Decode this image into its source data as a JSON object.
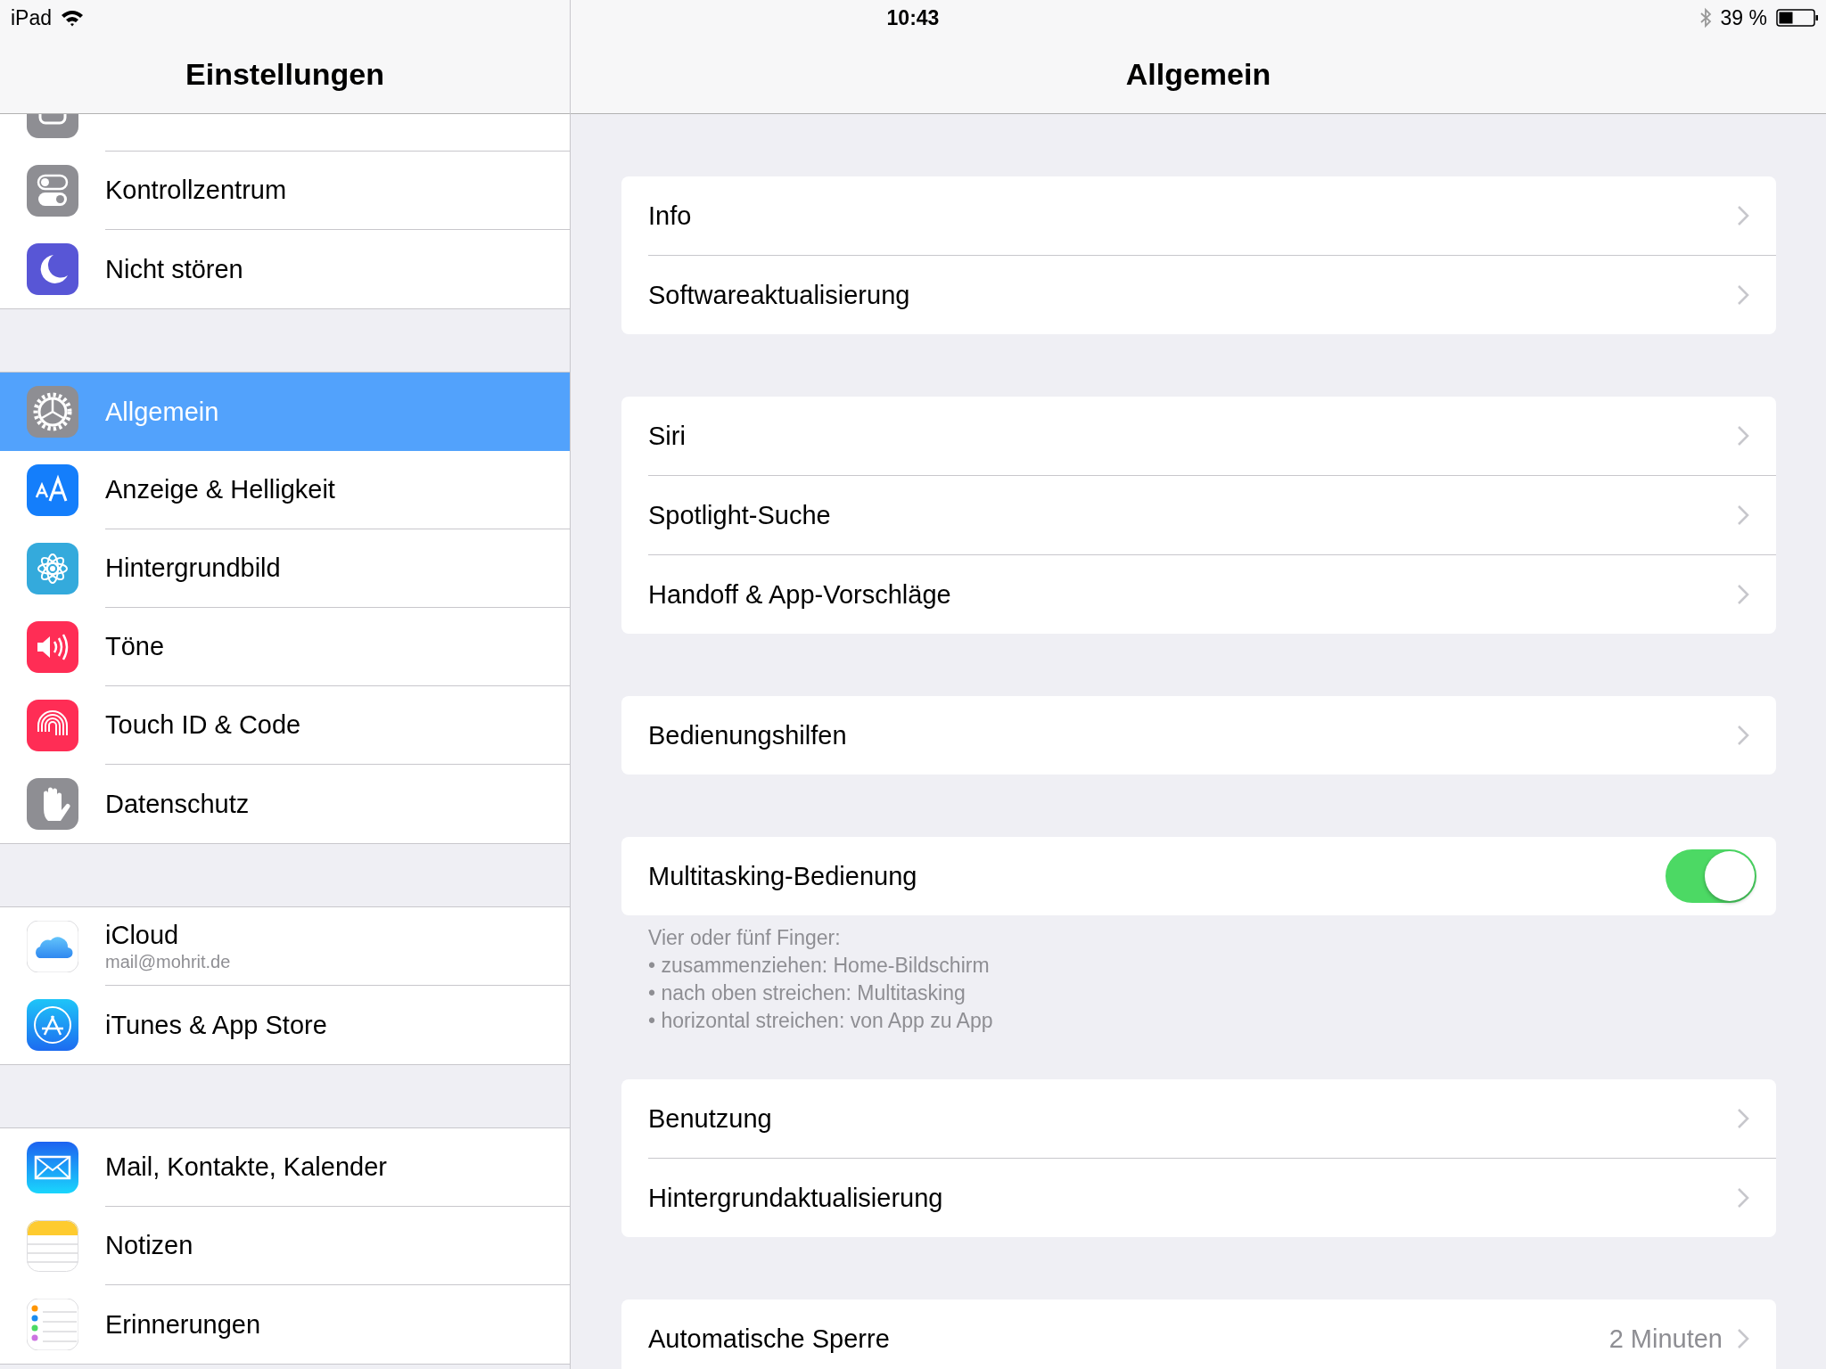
{
  "status_bar": {
    "device": "iPad",
    "time": "10:43",
    "battery_text": "39 %"
  },
  "sidebar": {
    "title": "Einstellungen",
    "sections": [
      {
        "items": [
          {
            "selected": false
          },
          {
            "label": "Kontrollzentrum",
            "selected": false
          },
          {
            "label": "Nicht stören",
            "selected": false
          }
        ]
      },
      {
        "items": [
          {
            "label": "Allgemein",
            "selected": true
          },
          {
            "label": "Anzeige & Helligkeit",
            "selected": false
          },
          {
            "label": "Hintergrundbild",
            "selected": false
          },
          {
            "label": "Töne",
            "selected": false
          },
          {
            "label": "Touch ID & Code",
            "selected": false
          },
          {
            "label": "Datenschutz",
            "selected": false
          }
        ]
      },
      {
        "items": [
          {
            "label": "iCloud",
            "subtitle": "mail@mohrit.de",
            "selected": false
          },
          {
            "label": "iTunes & App Store",
            "selected": false
          }
        ]
      },
      {
        "items": [
          {
            "label": "Mail, Kontakte, Kalender",
            "selected": false
          },
          {
            "label": "Notizen",
            "selected": false
          },
          {
            "label": "Erinnerungen",
            "selected": false
          }
        ]
      }
    ]
  },
  "detail": {
    "title": "Allgemein",
    "groups": [
      {
        "rows": [
          {
            "kind": "link",
            "label": "Info"
          },
          {
            "kind": "link",
            "label": "Softwareaktualisierung"
          }
        ]
      },
      {
        "rows": [
          {
            "kind": "link",
            "label": "Siri"
          },
          {
            "kind": "link",
            "label": "Spotlight-Suche"
          },
          {
            "kind": "link",
            "label": "Handoff & App-Vorschläge"
          }
        ]
      },
      {
        "rows": [
          {
            "kind": "link",
            "label": "Bedienungshilfen"
          }
        ]
      },
      {
        "rows": [
          {
            "kind": "toggle",
            "label": "Multitasking-Bedienung",
            "on": true
          }
        ],
        "footer": "Vier oder fünf Finger:\n• zusammenziehen: Home-Bildschirm\n• nach oben streichen: Multitasking\n• horizontal streichen: von App zu App"
      },
      {
        "rows": [
          {
            "kind": "link",
            "label": "Benutzung"
          },
          {
            "kind": "link",
            "label": "Hintergrundaktualisierung"
          }
        ]
      },
      {
        "rows": [
          {
            "kind": "link",
            "label": "Automatische Sperre",
            "detail": "2 Minuten"
          }
        ]
      }
    ]
  }
}
